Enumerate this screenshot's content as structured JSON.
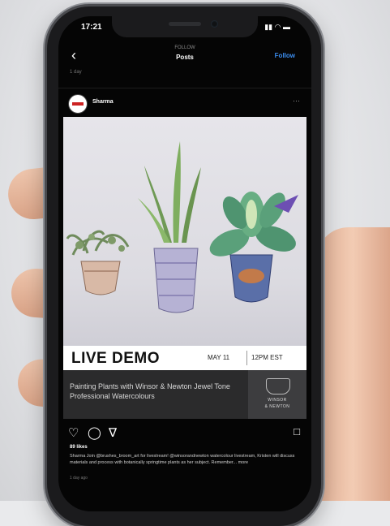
{
  "status_bar": {
    "time": "17:21",
    "icons": "▮▮ ◠ ▬"
  },
  "nav": {
    "back_icon": "chevron-left-icon",
    "subtitle": "FOLLOW",
    "title": "Posts",
    "follow_label": "Follow",
    "ago": "1 day"
  },
  "post": {
    "username": "Sharma",
    "more_label": "···",
    "banner": {
      "live": "LIVE DEMO",
      "date": "MAY 11",
      "time": "12PM EST"
    },
    "info": "Painting Plants with Winsor & Newton Jewel Tone Professional Watercolours",
    "logo": {
      "line1": "WINSOR",
      "line2": "& NEWTON"
    },
    "likes": "89 likes",
    "caption": "Sharma Join @brushes_broom_art for livestream! @winsorandnewton watercolour livestream, Kristen will discuss materials and process with botanically springtime plants as her subject. Remember... more",
    "posted": "1 day ago"
  }
}
